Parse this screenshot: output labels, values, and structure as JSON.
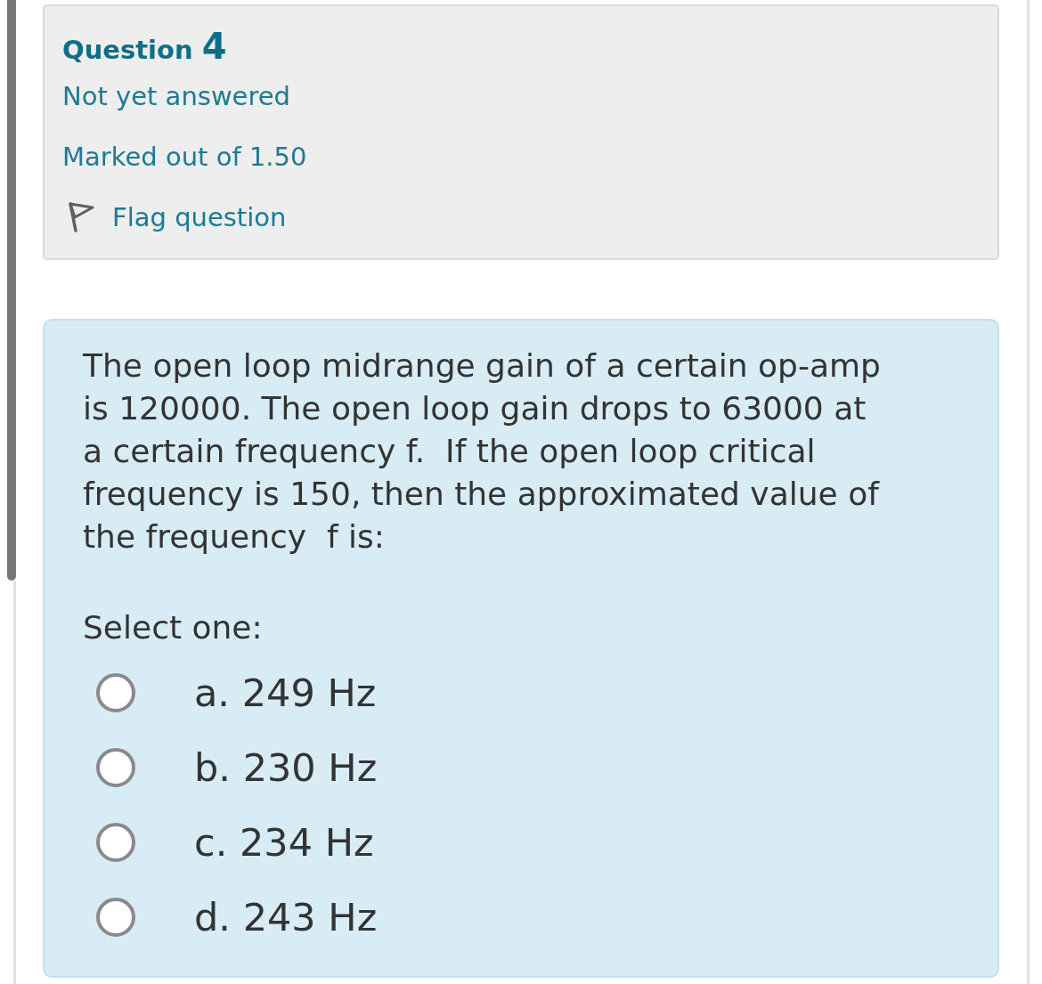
{
  "question_info": {
    "title": "Question",
    "number": "4",
    "status": "Not yet answered",
    "marks": "Marked out of 1.50",
    "flag": {
      "label": "Flag question",
      "flagged": false
    }
  },
  "question": {
    "text": "The open loop midrange gain of a certain op-amp is 120000. The open loop gain drops to 63000 at a certain frequency f.  If the open loop critical frequency is 150, then the approximated value of the frequency  f is:",
    "prompt": "Select one:",
    "options": [
      {
        "label": "a. 249 Hz",
        "selected": false
      },
      {
        "label": "b. 230 Hz",
        "selected": false
      },
      {
        "label": "c. 234 Hz",
        "selected": false
      },
      {
        "label": "d. 243 Hz",
        "selected": false
      }
    ]
  }
}
